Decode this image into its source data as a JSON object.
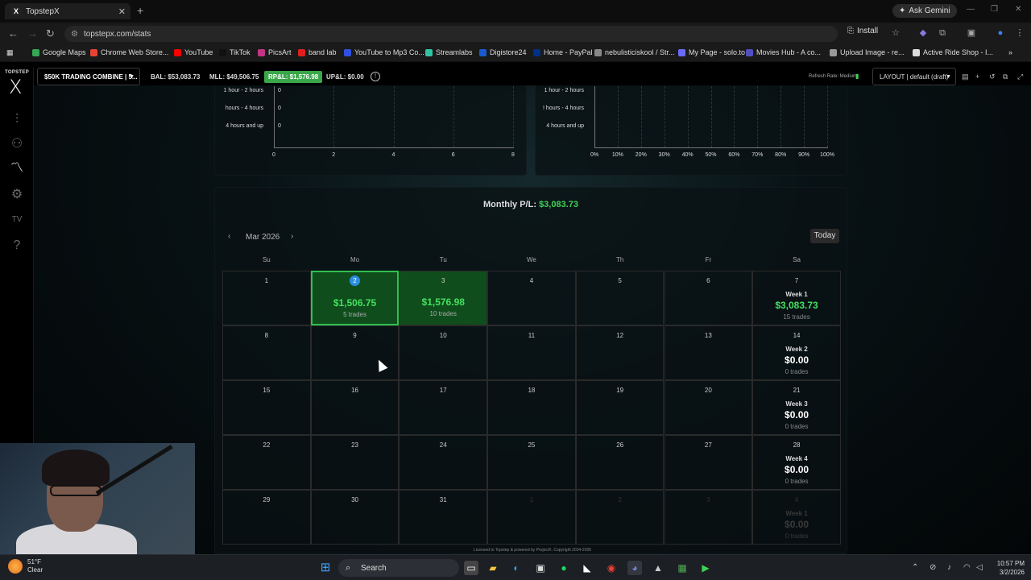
{
  "browser": {
    "tab_title": "TopstepX",
    "url": "topstepx.com/stats",
    "ask_gemini": "Ask Gemini",
    "install": "Install",
    "bookmarks": [
      {
        "label": "Google Maps",
        "color": "#34a853"
      },
      {
        "label": "Chrome Web Store...",
        "color": "#e94235"
      },
      {
        "label": "YouTube",
        "color": "#ff0000"
      },
      {
        "label": "TikTok",
        "color": "#111111"
      },
      {
        "label": "PicsArt",
        "color": "#c13584"
      },
      {
        "label": "band lab",
        "color": "#e02020"
      },
      {
        "label": "YouTube to Mp3 Co...",
        "color": "#3050e0"
      },
      {
        "label": "Streamlabs",
        "color": "#31c3a2"
      },
      {
        "label": "Digistore24",
        "color": "#1a5ad0"
      },
      {
        "label": "Home - PayPal",
        "color": "#003087"
      },
      {
        "label": "nebulisticiskool / Str...",
        "color": "#888888"
      },
      {
        "label": "My Page - solo.to",
        "color": "#6a6aff"
      },
      {
        "label": "Movies Hub - A co...",
        "color": "#5050c0"
      },
      {
        "label": "Upload Image - re...",
        "color": "#999999"
      },
      {
        "label": "Active Ride Shop - I...",
        "color": "#dddddd"
      }
    ]
  },
  "app": {
    "logo_small": "TOPSTEP",
    "logo_x": "X",
    "account": "$50K TRADING COMBINE | 5...",
    "bal": "BAL: $53,083.73",
    "mll": "MLL: $49,506.75",
    "rpl": "RP&L: $1,576.98",
    "upl": "UP&L: $0.00",
    "refresh_rate": "Refresh Rate: Medium",
    "layout": "LAYOUT | default (draft)"
  },
  "charts": {
    "left": {
      "rows": [
        {
          "label": "1 hour - 2 hours",
          "value": "0"
        },
        {
          "label": "hours - 4 hours",
          "value": "0"
        },
        {
          "label": "4 hours and up",
          "value": "0"
        }
      ],
      "xticks": [
        "0",
        "2",
        "4",
        "6",
        "8"
      ]
    },
    "right": {
      "rows": [
        {
          "label": "1 hour - 2 hours"
        },
        {
          "label": "! hours - 4 hours"
        },
        {
          "label": "4 hours and up"
        }
      ],
      "xticks": [
        "0%",
        "10%",
        "20%",
        "30%",
        "40%",
        "50%",
        "60%",
        "70%",
        "80%",
        "90%",
        "100%"
      ]
    }
  },
  "calendar": {
    "monthly_label": "Monthly P/L:",
    "monthly_value": "$3,083.73",
    "month": "Mar 2026",
    "today": "Today",
    "prev": "‹",
    "next": "›",
    "dow": [
      "Su",
      "Mo",
      "Tu",
      "We",
      "Th",
      "Fr",
      "Sa"
    ],
    "weeks": [
      {
        "days": [
          {
            "n": "1"
          },
          {
            "n": "2",
            "pnl": "$1,506.75",
            "trades": "5 trades",
            "state": "sel"
          },
          {
            "n": "3",
            "pnl": "$1,576.98",
            "trades": "10 trades",
            "state": "pos"
          },
          {
            "n": "4"
          },
          {
            "n": "5"
          },
          {
            "n": "6"
          }
        ],
        "sat": {
          "n": "7",
          "week": "Week 1",
          "total": "$3,083.73",
          "trades": "15 trades",
          "green": true
        }
      },
      {
        "days": [
          {
            "n": "8"
          },
          {
            "n": "9"
          },
          {
            "n": "10"
          },
          {
            "n": "11"
          },
          {
            "n": "12"
          },
          {
            "n": "13"
          }
        ],
        "sat": {
          "n": "14",
          "week": "Week 2",
          "total": "$0.00",
          "trades": "0 trades"
        }
      },
      {
        "days": [
          {
            "n": "15"
          },
          {
            "n": "16"
          },
          {
            "n": "17"
          },
          {
            "n": "18"
          },
          {
            "n": "19"
          },
          {
            "n": "20"
          }
        ],
        "sat": {
          "n": "21",
          "week": "Week 3",
          "total": "$0.00",
          "trades": "0 trades"
        }
      },
      {
        "days": [
          {
            "n": "22"
          },
          {
            "n": "23"
          },
          {
            "n": "24"
          },
          {
            "n": "25"
          },
          {
            "n": "26"
          },
          {
            "n": "27"
          }
        ],
        "sat": {
          "n": "28",
          "week": "Week 4",
          "total": "$0.00",
          "trades": "0 trades"
        }
      },
      {
        "days": [
          {
            "n": "29"
          },
          {
            "n": "30"
          },
          {
            "n": "31"
          },
          {
            "n": "1",
            "faded": true
          },
          {
            "n": "2",
            "faded": true
          },
          {
            "n": "3",
            "faded": true
          }
        ],
        "sat": {
          "n": "4",
          "week": "Week 1",
          "total": "$0.00",
          "trades": "0 trades",
          "faded": true
        }
      }
    ],
    "license": "Licensed to Topstep & powered by ProjectX. Copyright 2024-2026"
  },
  "taskbar": {
    "temp": "51°F",
    "condition": "Clear",
    "search": "Search",
    "time": "10:57 PM",
    "date": "3/2/2026"
  },
  "colors": {
    "positive": "#44e060",
    "positive_bg": "#0f4e1c",
    "selected_border": "#2fc050",
    "today_circle": "#2a8ee0"
  }
}
